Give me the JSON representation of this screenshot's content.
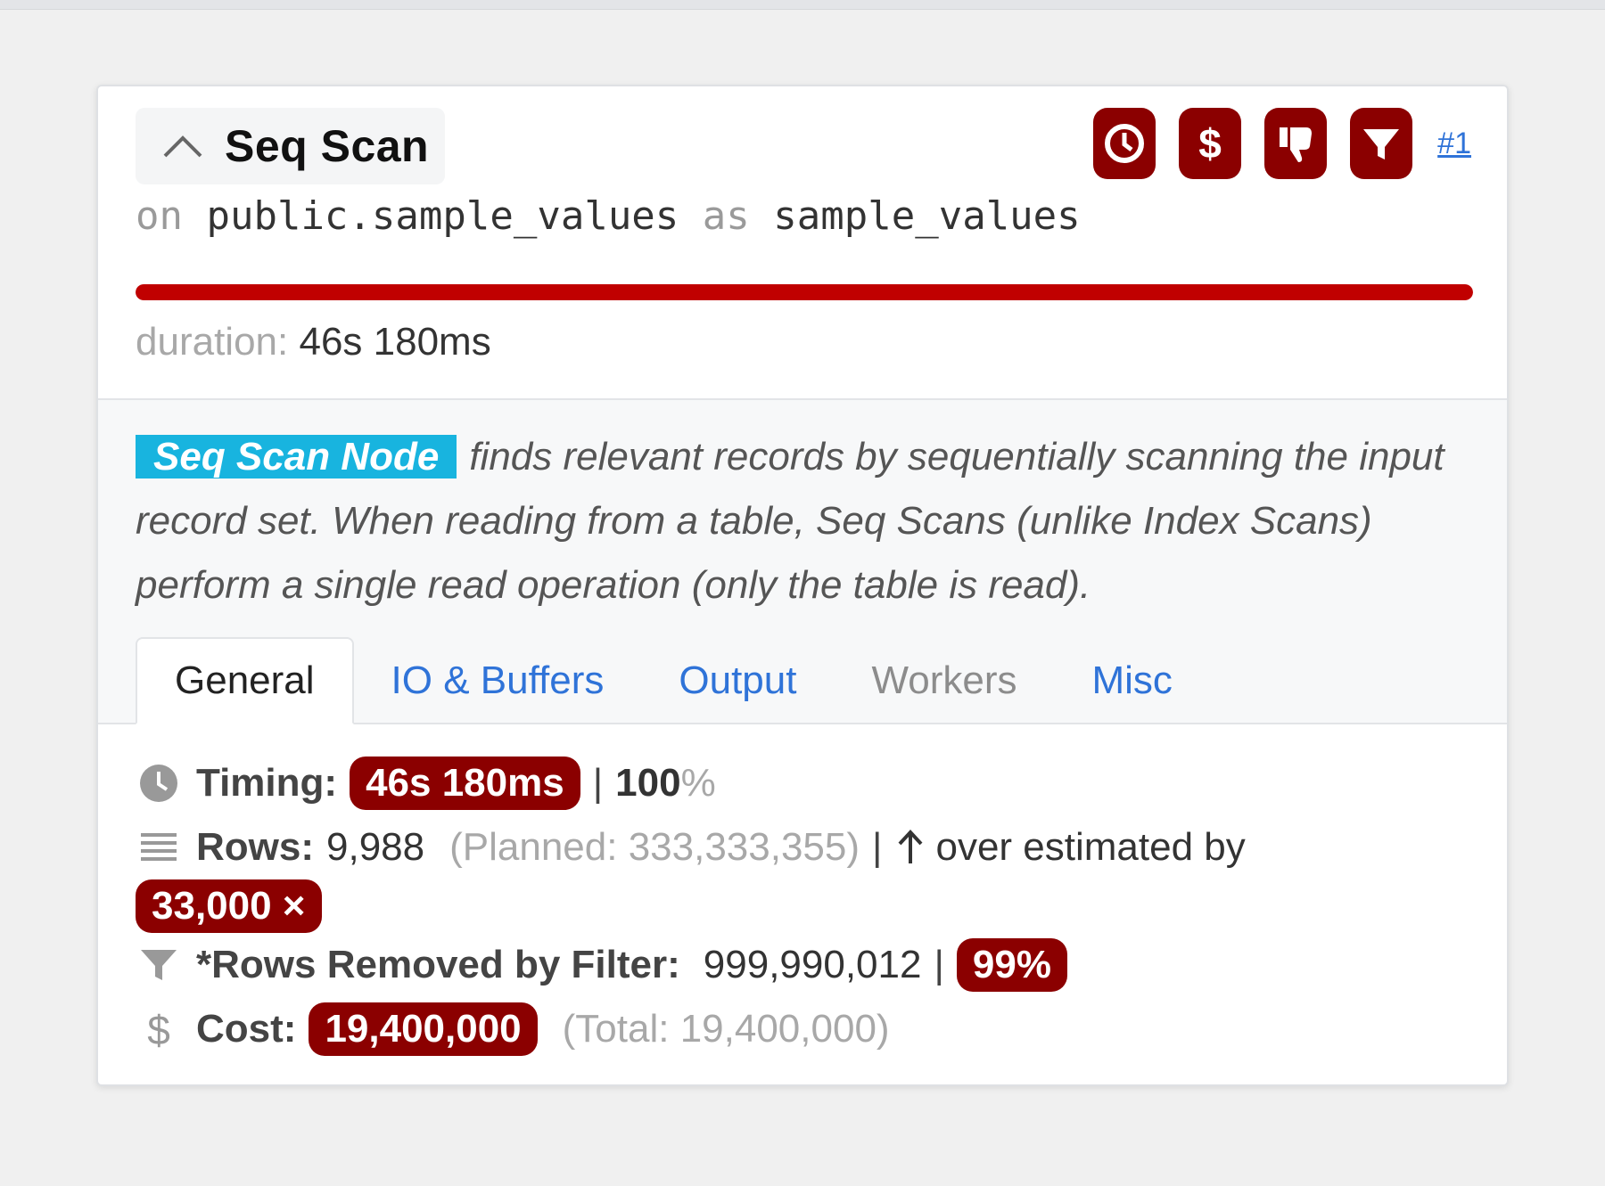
{
  "node": {
    "title": "Seq Scan",
    "link": "#1",
    "relation": {
      "on_kw": "on",
      "table": "public.sample_values",
      "as_kw": "as",
      "alias": "sample_values"
    },
    "progress_fraction": 1.0,
    "duration_label": "duration:",
    "duration_value": "46s 180ms",
    "header_icons": [
      "clock-icon",
      "dollar-icon",
      "thumbs-down-icon",
      "filter-icon"
    ]
  },
  "description": {
    "tag": "Seq Scan Node",
    "text": "finds relevant records by sequentially scanning the input record set. When reading from a table, Seq Scans (unlike Index Scans) perform a single read operation (only the table is read)."
  },
  "tabs": [
    {
      "label": "General",
      "state": "active"
    },
    {
      "label": "IO & Buffers",
      "state": "link"
    },
    {
      "label": "Output",
      "state": "link"
    },
    {
      "label": "Workers",
      "state": "disabled"
    },
    {
      "label": "Misc",
      "state": "link"
    }
  ],
  "stats": {
    "timing": {
      "label": "Timing:",
      "value": "46s 180ms",
      "sep": "|",
      "percent": "100",
      "percent_sign": "%"
    },
    "rows": {
      "label": "Rows:",
      "value": "9,988",
      "planned": "(Planned: 333,333,355)",
      "sep": "|",
      "note": "over estimated by",
      "factor": "33,000 ×"
    },
    "filter": {
      "label": "*Rows Removed by Filter:",
      "value": "999,990,012",
      "sep": "|",
      "percent": "99%"
    },
    "cost": {
      "label": "Cost:",
      "value": "19,400,000",
      "total": "(Total: 19,400,000)"
    }
  },
  "colors": {
    "danger": "#8b0000",
    "progress": "#c00000",
    "node_tag": "#18b4df",
    "link": "#2f73d8"
  }
}
